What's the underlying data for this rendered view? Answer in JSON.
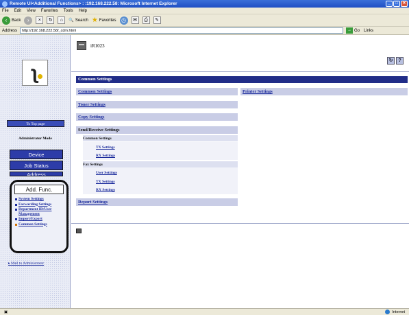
{
  "window": {
    "title": "Remote UI<Additional Functions> : :192.168.222.58: Microsoft Internet Explorer",
    "buttons": [
      "_",
      "□",
      "✕"
    ]
  },
  "menubar": [
    "File",
    "Edit",
    "View",
    "Favorites",
    "Tools",
    "Help"
  ],
  "toolbar": {
    "back": "Back",
    "search": "Search",
    "favorites": "Favorites"
  },
  "addressbar": {
    "label": "Address",
    "url": "http://192.168.222.58/_cdm.html",
    "go": "Go",
    "links": "Links"
  },
  "leftnav": {
    "top_page": "To Top page",
    "mode": "Administrator Mode",
    "device": "Device",
    "job_status": "Job Status",
    "address": "Address",
    "add_func": "Add. Func.",
    "links": [
      {
        "label": "System Settings"
      },
      {
        "label": "Forwarding Settings"
      },
      {
        "label": "Department ID/User Management"
      },
      {
        "label": "Import/Export"
      },
      {
        "label": "Common Settings"
      }
    ],
    "mail": "Mail to Administrator"
  },
  "main": {
    "device_name": "iR1023",
    "page_title": "Common Settings",
    "common_settings": "Common Settings",
    "printer_settings": "Printer Settings",
    "toner_settings": "Toner Settings",
    "copy_settings": "Copy Settings",
    "send_receive": "Send/Receive Settings",
    "sub_common": "Common Settings",
    "tx_settings": "TX Settings",
    "rx_settings": "RX Settings",
    "fax_settings": "Fax Settings",
    "user_settings": "User Settings",
    "fax_tx": "TX Settings",
    "fax_rx": "RX Settings",
    "report_settings": "Report Settings"
  },
  "statusbar": {
    "zone": "Internet"
  },
  "colors": {
    "nav_button": "#2d3ca8",
    "title_bar": "#202c88",
    "section_bg": "#c9cde6",
    "link": "#1a2a9c"
  }
}
